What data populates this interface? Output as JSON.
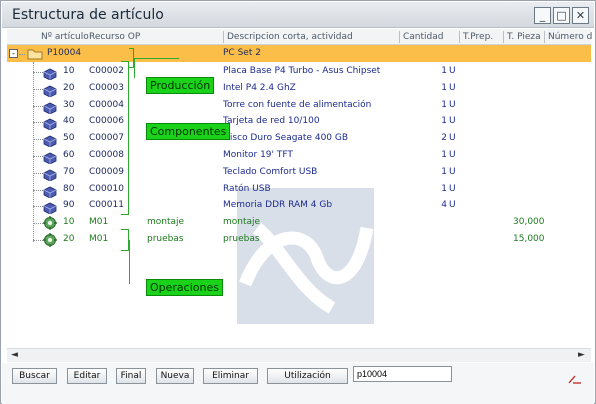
{
  "window": {
    "title": "Estructura de artículo"
  },
  "columns": [
    "Nº artículo",
    "Recurso OP",
    "Descripcion corta, actividad",
    "Cantidad",
    "T.Prep.",
    "T. Pieza",
    "Número d"
  ],
  "root": {
    "code": "P10004",
    "desc": "PC Set 2"
  },
  "components": [
    {
      "pos": "10",
      "code": "C00002",
      "desc": "Placa Base P4 Turbo - Asus Chipset",
      "qty": "1",
      "unit": "U"
    },
    {
      "pos": "20",
      "code": "C00003",
      "desc": "Intel P4 2.4 GhZ",
      "qty": "1",
      "unit": "U"
    },
    {
      "pos": "30",
      "code": "C00004",
      "desc": "Torre con fuente de alimentación",
      "qty": "1",
      "unit": "U"
    },
    {
      "pos": "40",
      "code": "C00006",
      "desc": "Tarjeta de red 10/100",
      "qty": "1",
      "unit": "U"
    },
    {
      "pos": "50",
      "code": "C00007",
      "desc": "Disco Duro Seagate 400 GB",
      "qty": "2",
      "unit": "U"
    },
    {
      "pos": "60",
      "code": "C00008",
      "desc": "Monitor 19' TFT",
      "qty": "1",
      "unit": "U"
    },
    {
      "pos": "70",
      "code": "C00009",
      "desc": "Teclado Comfort USB",
      "qty": "1",
      "unit": "U"
    },
    {
      "pos": "80",
      "code": "C00010",
      "desc": "Ratón USB",
      "qty": "1",
      "unit": "U"
    },
    {
      "pos": "90",
      "code": "C00011",
      "desc": "Memoria DDR RAM 4 Gb",
      "qty": "4",
      "unit": "U"
    }
  ],
  "operations": [
    {
      "pos": "10",
      "code": "M01",
      "resource": "montaje",
      "desc": "montaje",
      "tpieza": "30,000"
    },
    {
      "pos": "20",
      "code": "M01",
      "resource": "pruebas",
      "desc": "pruebas",
      "tpieza": "15,000"
    }
  ],
  "callouts": {
    "produccion": "Producción",
    "componentes": "Componentes",
    "operaciones": "Operaciones"
  },
  "buttons": [
    "Buscar",
    "Editar",
    "Final",
    "Nueva",
    "Eliminar",
    "Utilización"
  ],
  "search_value": "p10004",
  "colors": {
    "selected_row": "#fbbe48",
    "callout_bg": "#19d219",
    "operation_text": "#1c7a1c"
  }
}
